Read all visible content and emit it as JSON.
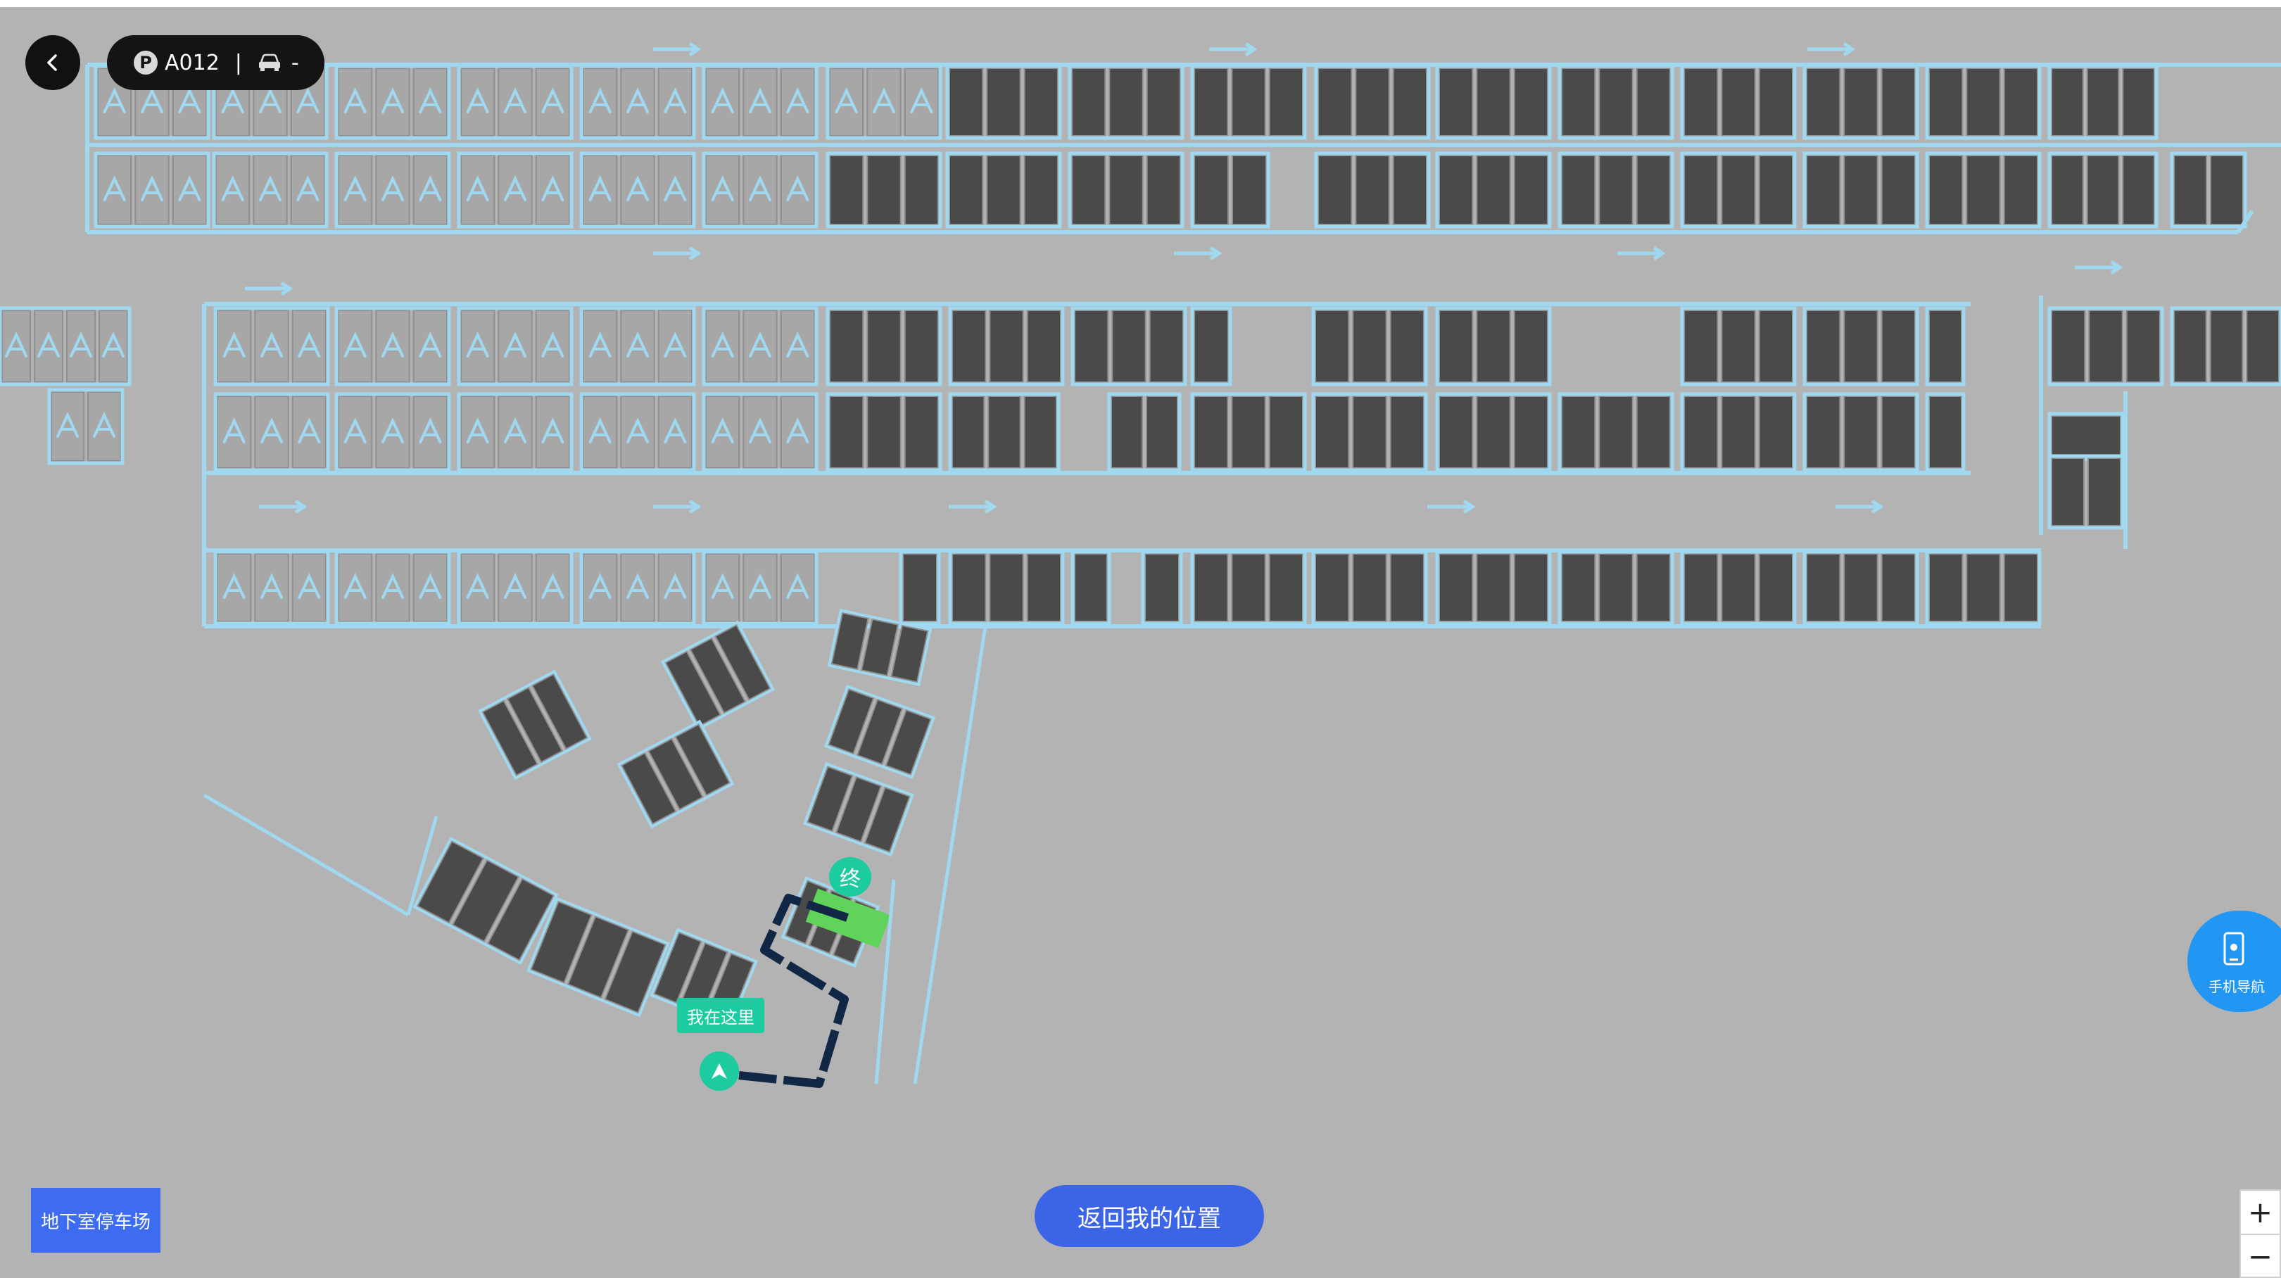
{
  "header": {
    "parking_badge": "P",
    "space_code": "A012",
    "separator": "|",
    "plate": "-"
  },
  "map": {
    "floor_label": "地下室停车场",
    "here_label": "我在这里",
    "destination_label": "终"
  },
  "controls": {
    "return_label": "返回我的位置",
    "phone_nav_label": "手机导航",
    "zoom_in": "+",
    "zoom_out": "−"
  },
  "icons": {
    "back": "chevron-left-icon",
    "car": "car-icon",
    "phone": "phone-icon",
    "location": "navigation-arrow-icon",
    "charging_space": "charging-plug-icon"
  },
  "colors": {
    "background": "#b4b3b4",
    "lot_outline": "#9fd8ef",
    "space_fill": "#4a4a4a",
    "route": "#102745",
    "destination_space": "#5fd35a",
    "accent_green": "#1ccba0",
    "button_blue": "#3c64e6"
  }
}
